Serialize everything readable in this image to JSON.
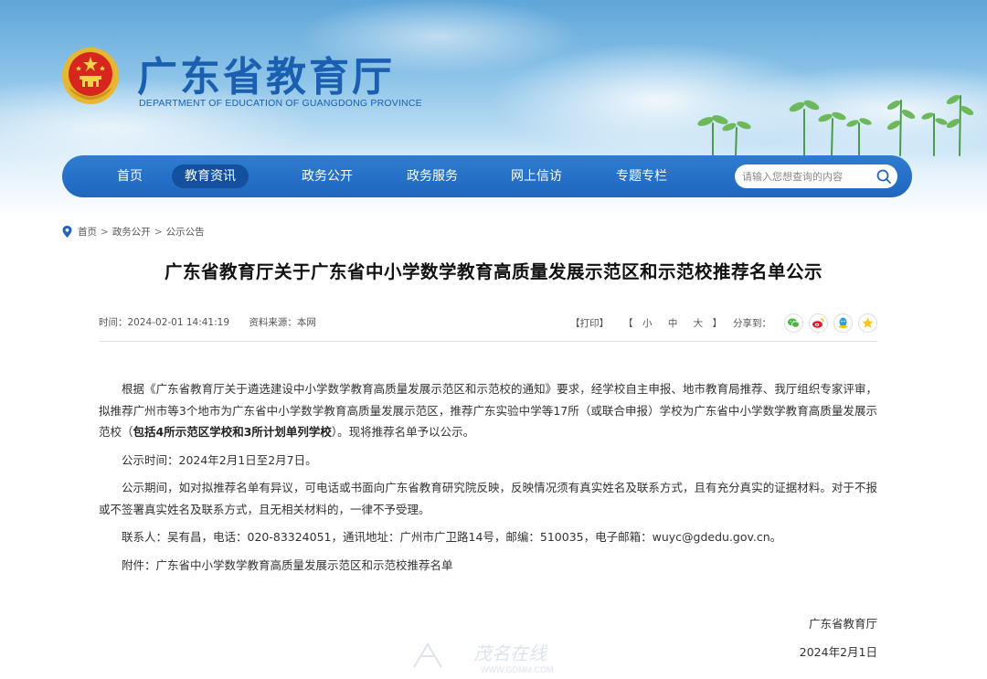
{
  "site": {
    "title": "广东省教育厅",
    "subtitle": "DEPARTMENT OF EDUCATION OF GUANGDONG PROVINCE",
    "brand_color": "#1a5fb0"
  },
  "nav": {
    "items": [
      {
        "label": "首页"
      },
      {
        "label": "教育资讯",
        "active": true
      },
      {
        "label": "政务公开"
      },
      {
        "label": "政务服务"
      },
      {
        "label": "网上信访"
      },
      {
        "label": "专题专栏"
      }
    ],
    "search_placeholder": "请输入您想查询的内容"
  },
  "breadcrumb": {
    "items": [
      "首页",
      "政务公开",
      "公示公告"
    ],
    "separator": ">"
  },
  "article": {
    "title": "广东省教育厅关于广东省中小学数学教育高质量发展示范区和示范校推荐名单公示",
    "time": "时间：2024-02-01 14:41:19",
    "source": "资料来源：本网",
    "print_label": "【打印】",
    "font_open": "【",
    "font_close": "】",
    "font_sizes": [
      "小",
      "中",
      "大"
    ],
    "share_label": "分享到：",
    "share_icons": [
      "wechat-icon",
      "weibo-icon",
      "qq-icon",
      "qzone-icon"
    ],
    "para1_a": "根据《广东省教育厅关于遴选建设中小学数学教育高质量发展示范区和示范校的通知》要求，经学校自主申报、地市教育局推荐、我厅组织专家评审，拟推荐广州市等3个地市为广东省中小学数学教育高质量发展示范区，推荐广东实验中学等17所（或联合申报）学校为广东省中小学数学教育高质量发展示范校（",
    "para1_bold": "包括4所示范区学校和3所计划单列学校",
    "para1_b": "）。现将推荐名单予以公示。",
    "para2": "公示时间：2024年2月1日至2月7日。",
    "para3": "公示期间，如对拟推荐名单有异议，可电话或书面向广东省教育研究院反映，反映情况须有真实姓名及联系方式，且有充分真实的证据材料。对于不报或不签署真实姓名及联系方式，且无相关材料的，一律不予受理。",
    "para4": "联系人：吴有昌，电话：020-83324051，通讯地址：广州市广卫路14号，邮编：510035，电子邮箱：wuyc@gdedu.gov.cn。",
    "para5": "附件：广东省中小学数学教育高质量发展示范区和示范校推荐名单",
    "sign_org": "广东省教育厅",
    "sign_date": "2024年2月1日"
  },
  "watermark": {
    "text": "茂名在线",
    "url": "WWW.GDMM.COM"
  }
}
